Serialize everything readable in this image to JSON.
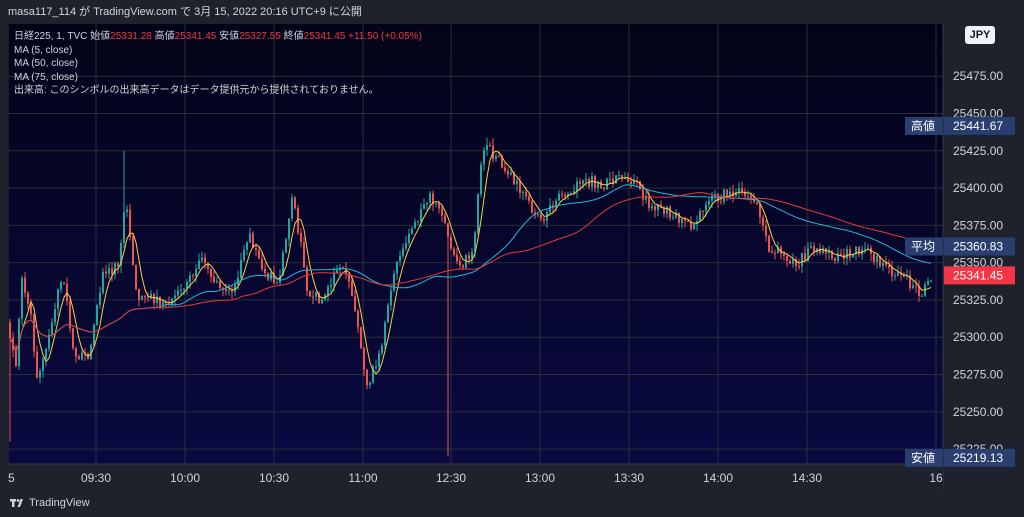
{
  "header": {
    "publish_line": "masa117_114 が TradingView.com で 3月 15, 2022 20:16 UTC+9 に公開"
  },
  "legend": {
    "symbol": "日経225, 1, TVC",
    "open_label": "始値",
    "open_value": "25331.28",
    "high_label": "高値",
    "high_value": "25341.45",
    "low_label": "安値",
    "low_value": "25327.55",
    "close_label": "終値",
    "close_value": "25341.45",
    "change": "+11.50 (+0.05%)",
    "ma5": "MA (5, close)",
    "ma50": "MA (50, close)",
    "ma75": "MA (75, close)",
    "volume_note": "出来高: このシンボルの出来高データはデータ提供元から提供されておりません。"
  },
  "currency": "JPY",
  "footer": {
    "brand": "TradingView"
  },
  "colors": {
    "up": "#26a69a",
    "down": "#ef5350",
    "ma5": "#f6d046",
    "ma50": "#29b6d6",
    "ma75": "#e53935",
    "price_tag": "#f23645",
    "info_tag": "#2a3f6f"
  },
  "chart_data": {
    "type": "candlestick",
    "symbol": "日経225",
    "interval": "1",
    "ylim": [
      25215,
      25510
    ],
    "yticks": [
      25225,
      25250,
      25275,
      25300,
      25325,
      25350,
      25375,
      25400,
      25425,
      25450,
      25475
    ],
    "y_tick_labels": [
      "25225.00",
      "25250.00",
      "25275.00",
      "25300.00",
      "25325.00",
      "25350.00",
      "25375.00",
      "25400.00",
      "25425.00",
      "25450.00",
      "25475.00"
    ],
    "x_tick_labels": [
      "5",
      "09:30",
      "10:00",
      "10:30",
      "11:00",
      "12:30",
      "13:00",
      "13:30",
      "14:00",
      "14:30",
      "16"
    ],
    "price_tags": [
      {
        "label": "高値",
        "value": "25441.67",
        "price": 25441.67,
        "kind": "info"
      },
      {
        "label": "平均",
        "value": "25360.83",
        "price": 25360.83,
        "kind": "info"
      },
      {
        "label": "",
        "value": "25341.45",
        "price": 25341.45,
        "kind": "last"
      },
      {
        "label": "安値",
        "value": "25219.13",
        "price": 25219.13,
        "kind": "info"
      }
    ],
    "waypoints": [
      [
        0,
        25310
      ],
      [
        8,
        25280
      ],
      [
        14,
        25340
      ],
      [
        22,
        25320
      ],
      [
        28,
        25270
      ],
      [
        40,
        25300
      ],
      [
        55,
        25345
      ],
      [
        65,
        25290
      ],
      [
        80,
        25285
      ],
      [
        95,
        25340
      ],
      [
        110,
        25350
      ],
      [
        118,
        25395
      ],
      [
        128,
        25330
      ],
      [
        145,
        25325
      ],
      [
        160,
        25322
      ],
      [
        180,
        25335
      ],
      [
        195,
        25355
      ],
      [
        210,
        25335
      ],
      [
        225,
        25330
      ],
      [
        240,
        25370
      ],
      [
        255,
        25345
      ],
      [
        270,
        25335
      ],
      [
        285,
        25395
      ],
      [
        300,
        25330
      ],
      [
        315,
        25325
      ],
      [
        330,
        25350
      ],
      [
        345,
        25330
      ],
      [
        360,
        25265
      ],
      [
        375,
        25300
      ],
      [
        390,
        25355
      ],
      [
        405,
        25375
      ],
      [
        420,
        25395
      ],
      [
        435,
        25380
      ],
      [
        450,
        25345
      ],
      [
        465,
        25360
      ],
      [
        475,
        25430
      ],
      [
        490,
        25420
      ],
      [
        505,
        25405
      ],
      [
        520,
        25390
      ],
      [
        535,
        25380
      ],
      [
        550,
        25395
      ],
      [
        565,
        25400
      ],
      [
        580,
        25405
      ],
      [
        595,
        25402
      ],
      [
        610,
        25408
      ],
      [
        625,
        25405
      ],
      [
        640,
        25390
      ],
      [
        655,
        25385
      ],
      [
        670,
        25380
      ],
      [
        685,
        25372
      ],
      [
        700,
        25392
      ],
      [
        715,
        25395
      ],
      [
        730,
        25400
      ],
      [
        745,
        25395
      ],
      [
        760,
        25360
      ],
      [
        775,
        25355
      ],
      [
        790,
        25350
      ],
      [
        805,
        25360
      ],
      [
        820,
        25355
      ],
      [
        835,
        25355
      ],
      [
        850,
        25358
      ],
      [
        865,
        25355
      ],
      [
        880,
        25345
      ],
      [
        895,
        25342
      ],
      [
        910,
        25330
      ],
      [
        922,
        25335
      ]
    ]
  }
}
